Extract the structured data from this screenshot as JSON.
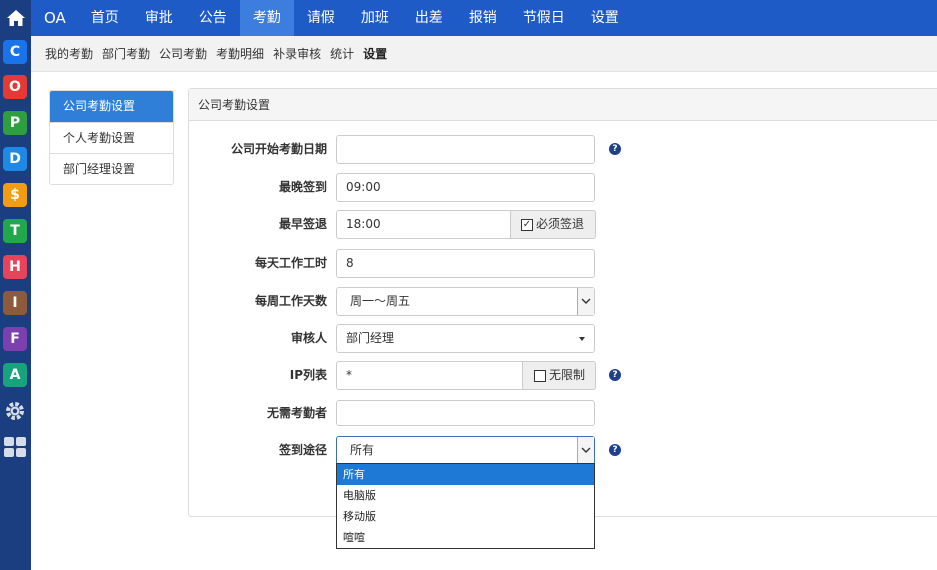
{
  "rail": {
    "items": [
      {
        "icon": "c-app-icon",
        "glyph": "C",
        "color": "#1a73e8"
      },
      {
        "icon": "o-app-icon",
        "glyph": "O",
        "color": "#e53935"
      },
      {
        "icon": "p-app-icon",
        "glyph": "P",
        "color": "#2e9e3e"
      },
      {
        "icon": "d-app-icon",
        "glyph": "D",
        "color": "#1e88e5"
      },
      {
        "icon": "dollar-app-icon",
        "glyph": "$",
        "color": "#f39c12"
      },
      {
        "icon": "t-app-icon",
        "glyph": "T",
        "color": "#21a84a"
      },
      {
        "icon": "printer-app-icon",
        "glyph": "H",
        "color": "#e8435a"
      },
      {
        "icon": "i-app-icon",
        "glyph": "I",
        "color": "#8d5a3b"
      },
      {
        "icon": "f-app-icon",
        "glyph": "F",
        "color": "#7b3fb0"
      },
      {
        "icon": "a-app-icon",
        "glyph": "A",
        "color": "#17a37c"
      }
    ]
  },
  "topnav": {
    "brand": "OA",
    "items": [
      "首页",
      "审批",
      "公告",
      "考勤",
      "请假",
      "加班",
      "出差",
      "报销",
      "节假日",
      "设置"
    ],
    "active_index": 3
  },
  "subnav": {
    "items": [
      "我的考勤",
      "部门考勤",
      "公司考勤",
      "考勤明细",
      "补录审核",
      "统计",
      "设置"
    ],
    "active_index": 6
  },
  "sidemenu": {
    "items": [
      "公司考勤设置",
      "个人考勤设置",
      "部门经理设置"
    ],
    "active_index": 0
  },
  "panel": {
    "title": "公司考勤设置",
    "fields": {
      "start_date": {
        "label": "公司开始考勤日期",
        "value": ""
      },
      "latest_checkin": {
        "label": "最晚签到",
        "value": "09:00"
      },
      "earliest_checkout": {
        "label": "最早签退",
        "value": "18:00",
        "addon": "必须签退",
        "checked": true
      },
      "daily_hours": {
        "label": "每天工作工时",
        "value": "8"
      },
      "weekly_days": {
        "label": "每周工作天数",
        "value": "周一～周五"
      },
      "reviewer": {
        "label": "审核人",
        "value": "部门经理"
      },
      "ip_list": {
        "label": "IP列表",
        "value": "*",
        "addon": "无限制",
        "checked": false
      },
      "exempt": {
        "label": "无需考勤者",
        "value": ""
      },
      "checkin_channel": {
        "label": "签到途径",
        "value": "所有",
        "options": [
          "所有",
          "电脑版",
          "移动版",
          "喧喧"
        ],
        "selected_index": 0
      }
    }
  },
  "colors": {
    "nav": "#1e5bc6",
    "nav_active": "#3d7ddd",
    "rail": "#1a3e7f",
    "accent": "#2f7fd8",
    "help": "#1d3f8c"
  }
}
